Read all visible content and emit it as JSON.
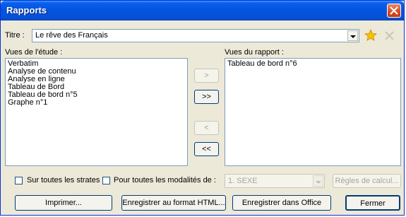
{
  "window": {
    "title": "Rapports"
  },
  "title_field": {
    "label": "Titre :",
    "value": "Le rêve des Français"
  },
  "left_list": {
    "label": "Vues de l'étude :",
    "items": [
      "Verbatim",
      "Analyse de contenu",
      "Analyse en ligne",
      "Tableau de Bord",
      "Tableau de bord n°5",
      "Graphe n°1"
    ]
  },
  "right_list": {
    "label": "Vues du rapport :",
    "items": [
      "Tableau de bord n°6"
    ]
  },
  "transfer_buttons": {
    "add": ">",
    "add_all": ">>",
    "remove": "<",
    "remove_all": "<<"
  },
  "options": {
    "all_strata_label": "Sur toutes les strates",
    "all_modalities_label": "Pour toutes les modalités de :",
    "modality_value": "1. SEXE",
    "calc_rules_label": "Règles de calcul..."
  },
  "footer": {
    "print": "Imprimer...",
    "save_html": "Enregistrer au format HTML...",
    "save_office": "Enregistrer dans Office",
    "close": "Fermer"
  },
  "colors": {
    "titlebar": "#0553e1",
    "dialog_bg": "#ece9d8",
    "star": "#f5c400"
  }
}
